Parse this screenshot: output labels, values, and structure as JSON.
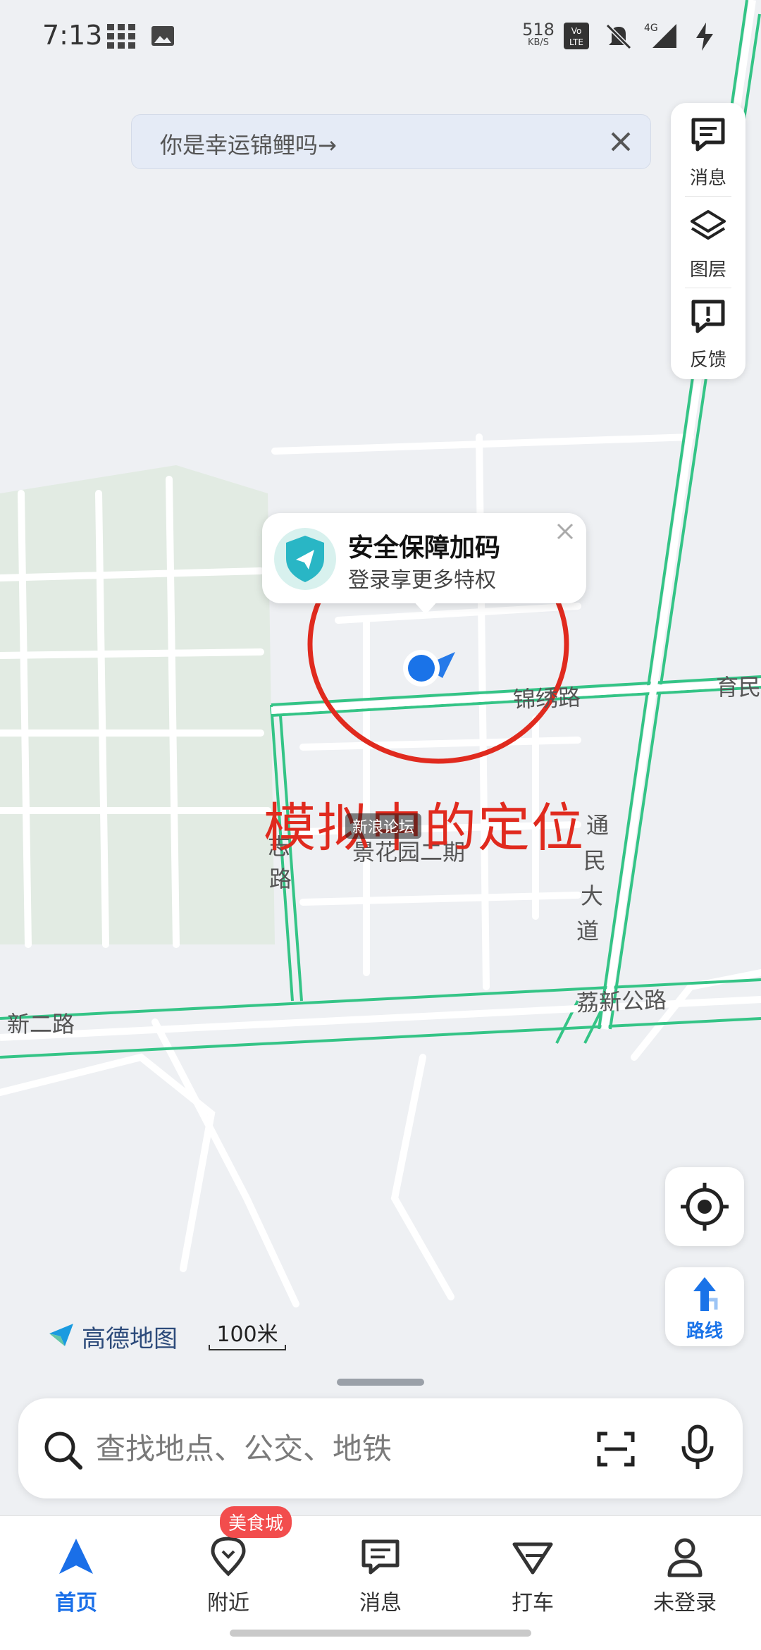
{
  "status_bar": {
    "time": "7:13",
    "net_speed_value": "518",
    "net_speed_unit": "KB/S",
    "network": "4G",
    "icons": [
      "grid-icon",
      "image-icon",
      "volte-icon",
      "mute-icon",
      "signal-icon",
      "charging-icon"
    ]
  },
  "banner": {
    "text": "你是幸运锦鲤吗→"
  },
  "right_panel": {
    "items": [
      {
        "label": "消息",
        "icon": "message-icon"
      },
      {
        "label": "图层",
        "icon": "layers-icon"
      },
      {
        "label": "反馈",
        "icon": "feedback-icon"
      }
    ]
  },
  "popup": {
    "title": "安全保障加码",
    "subtitle": "登录享更多特权",
    "icon": "shield-icon"
  },
  "map": {
    "road_labels": {
      "jinxiu": "锦绣路",
      "yumin": "育民",
      "lixin": "荔新公路",
      "xin_er": "新二路",
      "tongmin_1": "通",
      "tongmin_2": "民",
      "tongmin_3": "大",
      "tongmin_4": "道",
      "zhi_road": "志",
      "zhi_road_2": "路",
      "garden": "景花园二期"
    },
    "annotation": "模拟中的定位",
    "watermark": "新浪论坛",
    "annotation_color": "#e02a1e"
  },
  "map_brand": {
    "logo_text": "高德地图",
    "scale_text": "100米"
  },
  "route_button": {
    "label": "路线"
  },
  "search": {
    "placeholder": "查找地点、公交、地铁"
  },
  "tabs": {
    "home": "首页",
    "nearby": "附近",
    "nearby_badge": "美食城",
    "messages": "消息",
    "taxi": "打车",
    "login": "未登录"
  },
  "colors": {
    "accent": "#1a6fe8",
    "road_green": "#34c486",
    "badge": "#f24d4d"
  }
}
